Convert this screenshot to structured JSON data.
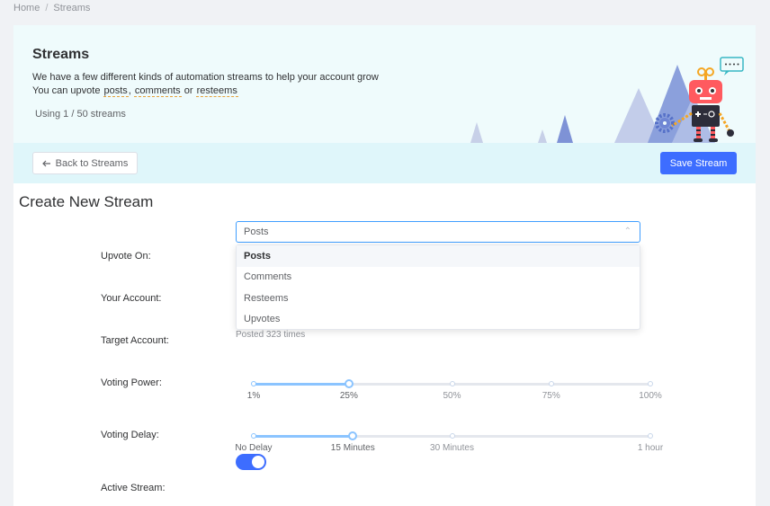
{
  "breadcrumb": {
    "home": "Home",
    "separator": "/",
    "current": "Streams"
  },
  "hero": {
    "title": "Streams",
    "line1": "We have a few different kinds of automation streams to help your account grow",
    "line2_prefix": "You can upvote",
    "link_posts": "posts",
    "comma": ",",
    "link_comments": "comments",
    "or": "or",
    "link_resteems": "resteems",
    "usage": "Using 1 / 50 streams"
  },
  "toolbar": {
    "back_label": "Back to Streams",
    "back_icon": "arrow-left-icon",
    "save_label": "Save Stream"
  },
  "form": {
    "title": "Create New Stream",
    "upvote_on": {
      "label": "Upvote On",
      "value": "Posts",
      "options": [
        "Posts",
        "Comments",
        "Resteems",
        "Upvotes"
      ],
      "selected_index": 0
    },
    "your_account": {
      "label": "Your Account"
    },
    "target_account": {
      "label": "Target Account",
      "hint": "Posted 323 times"
    },
    "voting_power": {
      "label": "Voting Power",
      "marks": [
        "1%",
        "25%",
        "50%",
        "75%",
        "100%"
      ],
      "value_index": 1
    },
    "voting_delay": {
      "label": "Voting Delay",
      "marks": [
        "No Delay",
        "15 Minutes",
        "30 Minutes",
        "1 hour"
      ],
      "value_index": 1
    },
    "active_stream": {
      "label": "Active Stream",
      "on": true
    }
  },
  "colors": {
    "accent": "#3d6dff",
    "hero_bg": "#effbfc",
    "toolbar_bg": "#dff6fa",
    "slider_fill": "#8bc4ff",
    "link_underline": "#e6a23c"
  }
}
